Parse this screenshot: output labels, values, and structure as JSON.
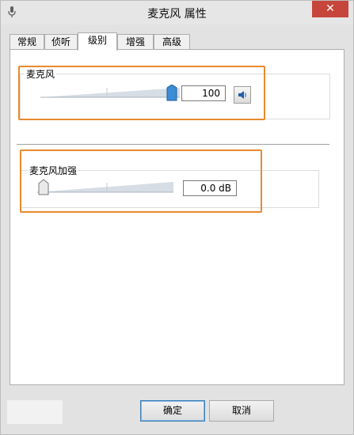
{
  "window": {
    "title": "麦克风 属性",
    "close_label": "✕"
  },
  "tabs": [
    {
      "label": "常规",
      "active": false
    },
    {
      "label": "侦听",
      "active": false
    },
    {
      "label": "级别",
      "active": true
    },
    {
      "label": "增强",
      "active": false
    },
    {
      "label": "高级",
      "active": false
    }
  ],
  "microphone": {
    "label": "麦克风",
    "value_text": "100",
    "level_percent": 100,
    "speaker_icon": "speaker-icon"
  },
  "boost": {
    "label": "麦克风加强",
    "value_text": "0.0 dB",
    "level_percent": 0
  },
  "buttons": {
    "ok": "确定",
    "cancel": "取消"
  },
  "colors": {
    "highlight": "#e88a2e",
    "close": "#c7463b",
    "thumb_active": "#3c8cd6"
  }
}
